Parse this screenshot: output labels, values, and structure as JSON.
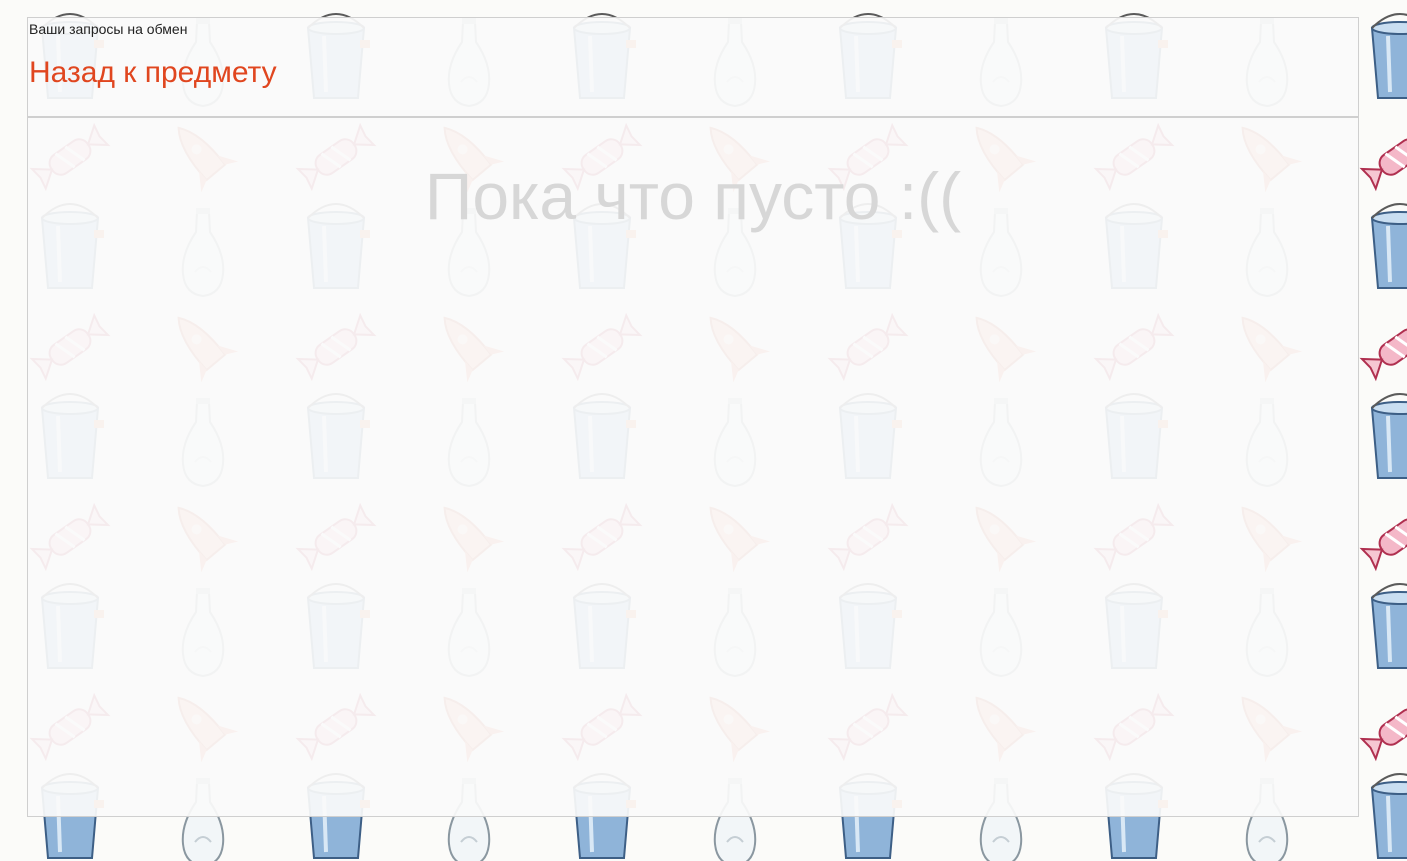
{
  "page": {
    "subtitle": "Ваши запросы на обмен",
    "back_link": "Назад к предмету",
    "empty_message": "Пока что пусто :(("
  },
  "background": {
    "pattern_icons": [
      "bucket-icon",
      "lightbulb-icon",
      "candy-icon",
      "rocket-icon"
    ]
  },
  "colors": {
    "accent": "#e0461f",
    "empty_text": "#d7d7d7",
    "panel_bg": "#fafafa"
  }
}
